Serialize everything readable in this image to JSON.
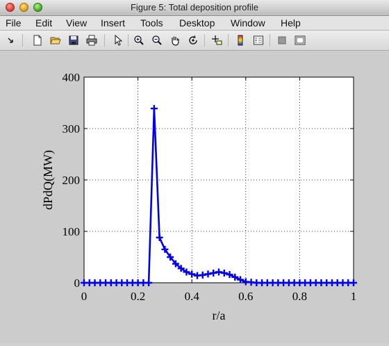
{
  "window": {
    "title": "Figure 5: Total deposition profile"
  },
  "menu": {
    "items": [
      "File",
      "Edit",
      "View",
      "Insert",
      "Tools",
      "Desktop",
      "Window",
      "Help"
    ]
  },
  "toolbar": {
    "icons": [
      "dock-arrow-icon",
      "new-figure-icon",
      "open-file-icon",
      "save-icon",
      "print-icon",
      "select-arrow-icon",
      "zoom-in-icon",
      "zoom-out-icon",
      "pan-hand-icon",
      "rotate-3d-icon",
      "data-cursor-icon",
      "colorbar-icon",
      "legend-icon",
      "hide-plot-tools-icon",
      "show-plot-tools-icon"
    ]
  },
  "chart_data": {
    "type": "line",
    "title": "",
    "xlabel": "r/a",
    "ylabel": "dPdQ(MW)",
    "xlim": [
      0,
      1
    ],
    "ylim": [
      0,
      400
    ],
    "xticks": [
      "0",
      "0.2",
      "0.4",
      "0.6",
      "0.8",
      "1"
    ],
    "yticks": [
      "0",
      "100",
      "200",
      "300",
      "400"
    ],
    "grid": true,
    "marker": "+",
    "color": "#0000ee",
    "series": [
      {
        "x": [
          0,
          0.02,
          0.04,
          0.06,
          0.08,
          0.1,
          0.12,
          0.14,
          0.16,
          0.18,
          0.2,
          0.22,
          0.24,
          0.26,
          0.28,
          0.3,
          0.32,
          0.34,
          0.36,
          0.38,
          0.4,
          0.42,
          0.44,
          0.46,
          0.48,
          0.5,
          0.52,
          0.54,
          0.56,
          0.58,
          0.6,
          0.62,
          0.64,
          0.66,
          0.68,
          0.7,
          0.72,
          0.74,
          0.76,
          0.78,
          0.8,
          0.82,
          0.84,
          0.86,
          0.88,
          0.9,
          0.92,
          0.94,
          0.96,
          0.98,
          1.0
        ],
        "y": [
          0,
          0,
          0,
          0,
          0,
          0,
          0,
          0,
          0,
          0,
          0,
          0,
          0,
          339,
          88,
          65,
          50,
          37,
          28,
          21,
          17,
          14,
          15,
          17,
          19,
          21,
          19,
          16,
          11,
          6,
          2,
          1,
          0,
          0,
          0,
          0,
          0,
          0,
          0,
          0,
          0,
          0,
          0,
          0,
          0,
          0,
          0,
          0,
          0,
          0,
          0
        ]
      }
    ]
  }
}
